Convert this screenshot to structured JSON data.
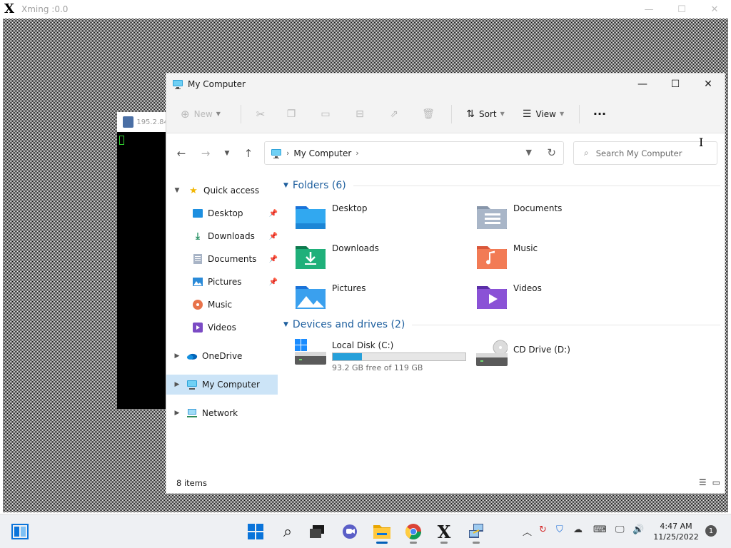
{
  "xming": {
    "title": "Xming :0.0",
    "minimize": "—",
    "maximize": "☐",
    "close": "✕"
  },
  "terminal": {
    "title": "195.2.84"
  },
  "explorer": {
    "title": "My Computer",
    "minimize": "—",
    "maximize": "☐",
    "close": "✕",
    "toolbar": {
      "new_label": "New",
      "sort_label": "Sort",
      "view_label": "View",
      "more_label": "···"
    },
    "address": {
      "crumb": "My Computer",
      "sep1": "›",
      "sep2": "›"
    },
    "search": {
      "placeholder": "Search My Computer"
    },
    "nav": {
      "quick_access": "Quick access",
      "items": [
        "Desktop",
        "Downloads",
        "Documents",
        "Pictures",
        "Music",
        "Videos"
      ],
      "onedrive": "OneDrive",
      "my_computer": "My Computer",
      "network": "Network"
    },
    "groups": {
      "folders": "Folders (6)",
      "devices": "Devices and drives (2)"
    },
    "folders": [
      "Desktop",
      "Documents",
      "Downloads",
      "Music",
      "Pictures",
      "Videos"
    ],
    "drives": {
      "c_name": "Local Disk (C:)",
      "c_free": "93.2 GB free of 119 GB",
      "c_used_fraction": 0.22,
      "d_name": "CD Drive (D:)"
    },
    "status": {
      "count": "8 items"
    }
  },
  "taskbar": {
    "time": "4:47 AM",
    "date": "11/25/2022",
    "notifications": "1"
  }
}
